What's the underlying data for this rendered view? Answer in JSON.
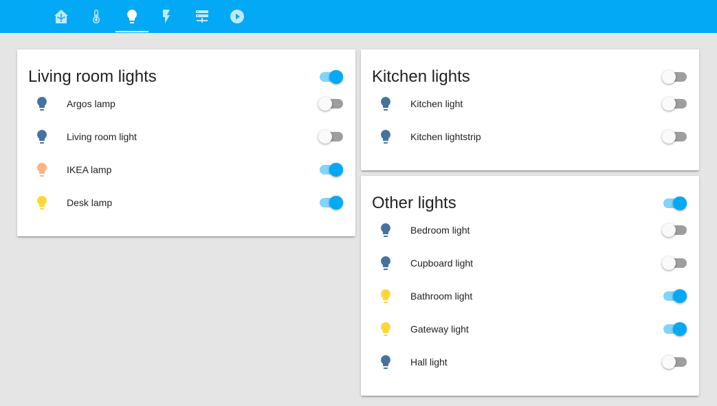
{
  "nav": {
    "tabs": [
      {
        "icon": "home-assistant-icon"
      },
      {
        "icon": "thermometer-icon"
      },
      {
        "icon": "lightbulb-icon",
        "active": true
      },
      {
        "icon": "flash-icon"
      },
      {
        "icon": "server-network-icon"
      },
      {
        "icon": "play-circle-icon"
      }
    ]
  },
  "colors": {
    "header": "#03a9f4",
    "bulb_off": "#44739e",
    "bulb_yellow": "#fdd835",
    "bulb_peach": "#ffb27d"
  },
  "cards": {
    "living": {
      "title": "Living room lights",
      "master_on": true,
      "items": [
        {
          "label": "Argos lamp",
          "on": false,
          "icon_color": "#44739e"
        },
        {
          "label": "Living room light",
          "on": false,
          "icon_color": "#44739e"
        },
        {
          "label": "IKEA lamp",
          "on": true,
          "icon_color": "#ffb27d"
        },
        {
          "label": "Desk lamp",
          "on": true,
          "icon_color": "#fdd835"
        }
      ]
    },
    "kitchen": {
      "title": "Kitchen lights",
      "master_on": false,
      "items": [
        {
          "label": "Kitchen light",
          "on": false,
          "icon_color": "#44739e"
        },
        {
          "label": "Kitchen lightstrip",
          "on": false,
          "icon_color": "#44739e"
        }
      ]
    },
    "other": {
      "title": "Other lights",
      "master_on": true,
      "items": [
        {
          "label": "Bedroom light",
          "on": false,
          "icon_color": "#44739e"
        },
        {
          "label": "Cupboard light",
          "on": false,
          "icon_color": "#44739e"
        },
        {
          "label": "Bathroom light",
          "on": true,
          "icon_color": "#fdd835"
        },
        {
          "label": "Gateway light",
          "on": true,
          "icon_color": "#fdd835"
        },
        {
          "label": "Hall light",
          "on": false,
          "icon_color": "#44739e"
        }
      ]
    }
  }
}
